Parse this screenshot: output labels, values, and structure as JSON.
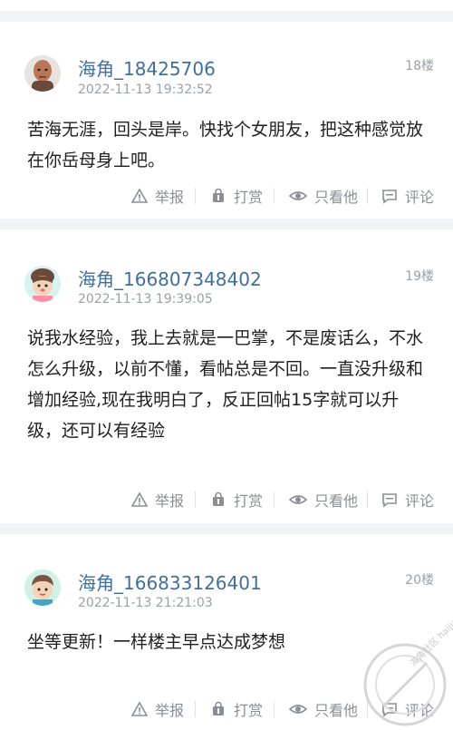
{
  "posts": [
    {
      "username": "海角_18425706",
      "time": "2022-11-13 19:32:52",
      "floor": "18楼",
      "content": "苦海无涯，回头是岸。快找个女朋友，把这种感觉放在你岳母身上吧。",
      "avatar": "man-photo-icon"
    },
    {
      "username": "海角_166807348402",
      "time": "2022-11-13 19:39:05",
      "floor": "19楼",
      "content": "说我水经验，我上去就是一巴掌，不是废话么，不水怎么升级，以前不懂，看帖总是不回。一直没升级和增加经验,现在我明白了，反正回帖15字就可以升级，还可以有经验",
      "avatar": "cartoon-girl-icon"
    },
    {
      "username": "海角_166833126401",
      "time": "2022-11-13 21:21:03",
      "floor": "20楼",
      "content": "坐等更新！一样楼主早点达成梦想",
      "avatar": "cartoon-boy-icon"
    }
  ],
  "actions": {
    "report": "举报",
    "reward": "打赏",
    "only_him": "只看他",
    "comment": "评论"
  },
  "watermark": {
    "brand": "海角社区",
    "domain": "haijiao.com"
  },
  "colors": {
    "username": "#3f6f9a",
    "meta": "#9aa0a6",
    "action": "#8a8f95",
    "separator": "#f2f3f5"
  }
}
